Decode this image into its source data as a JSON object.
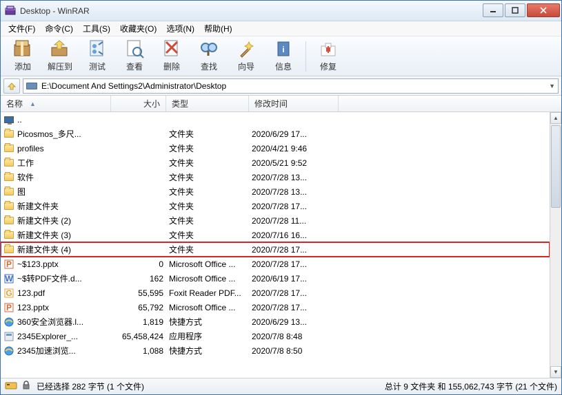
{
  "window": {
    "title": "Desktop - WinRAR"
  },
  "menu": [
    "文件(F)",
    "命令(C)",
    "工具(S)",
    "收藏夹(O)",
    "选项(N)",
    "帮助(H)"
  ],
  "toolbar": {
    "add": "添加",
    "extract": "解压到",
    "test": "测试",
    "view": "查看",
    "delete": "删除",
    "find": "查找",
    "wizard": "向导",
    "info": "信息",
    "repair": "修复"
  },
  "address": "E:\\Document And Settings2\\Administrator\\Desktop",
  "columns": {
    "name": "名称",
    "size": "大小",
    "type": "类型",
    "date": "修改时间"
  },
  "rows": [
    {
      "icon": "up",
      "name": "..",
      "size": "",
      "type": "",
      "date": ""
    },
    {
      "icon": "folder",
      "name": "Picosmos_多尺...",
      "size": "",
      "type": "文件夹",
      "date": "2020/6/29 17..."
    },
    {
      "icon": "folder",
      "name": "profiles",
      "size": "",
      "type": "文件夹",
      "date": "2020/4/21 9:46"
    },
    {
      "icon": "folder",
      "name": "工作",
      "size": "",
      "type": "文件夹",
      "date": "2020/5/21 9:52"
    },
    {
      "icon": "folder",
      "name": "软件",
      "size": "",
      "type": "文件夹",
      "date": "2020/7/28 13..."
    },
    {
      "icon": "folder",
      "name": "图",
      "size": "",
      "type": "文件夹",
      "date": "2020/7/28 13..."
    },
    {
      "icon": "folder",
      "name": "新建文件夹",
      "size": "",
      "type": "文件夹",
      "date": "2020/7/28 17..."
    },
    {
      "icon": "folder",
      "name": "新建文件夹 (2)",
      "size": "",
      "type": "文件夹",
      "date": "2020/7/28 11..."
    },
    {
      "icon": "folder",
      "name": "新建文件夹 (3)",
      "size": "",
      "type": "文件夹",
      "date": "2020/7/16 16..."
    },
    {
      "icon": "folder",
      "name": "新建文件夹 (4)",
      "size": "",
      "type": "文件夹",
      "date": "2020/7/28 17...",
      "hl": true
    },
    {
      "icon": "pptx",
      "name": "~$123.pptx",
      "size": "0",
      "type": "Microsoft Office ...",
      "date": "2020/7/28 17..."
    },
    {
      "icon": "docx",
      "name": "~$转PDF文件.d...",
      "size": "162",
      "type": "Microsoft Office ...",
      "date": "2020/6/19 17..."
    },
    {
      "icon": "pdf",
      "name": "123.pdf",
      "size": "55,595",
      "type": "Foxit Reader PDF...",
      "date": "2020/7/28 17..."
    },
    {
      "icon": "pptx",
      "name": "123.pptx",
      "size": "65,792",
      "type": "Microsoft Office ...",
      "date": "2020/7/28 17..."
    },
    {
      "icon": "ie",
      "name": "360安全浏览器.l...",
      "size": "1,819",
      "type": "快捷方式",
      "date": "2020/6/29 13..."
    },
    {
      "icon": "exe",
      "name": "2345Explorer_...",
      "size": "65,458,424",
      "type": "应用程序",
      "date": "2020/7/8 8:48"
    },
    {
      "icon": "ie",
      "name": "2345加速浏览...",
      "size": "1,088",
      "type": "快捷方式",
      "date": "2020/7/8 8:50"
    }
  ],
  "status": {
    "left": "已经选择 282 字节 (1 个文件)",
    "right": "总计 9 文件夹 和 155,062,743 字节 (21 个文件)"
  }
}
